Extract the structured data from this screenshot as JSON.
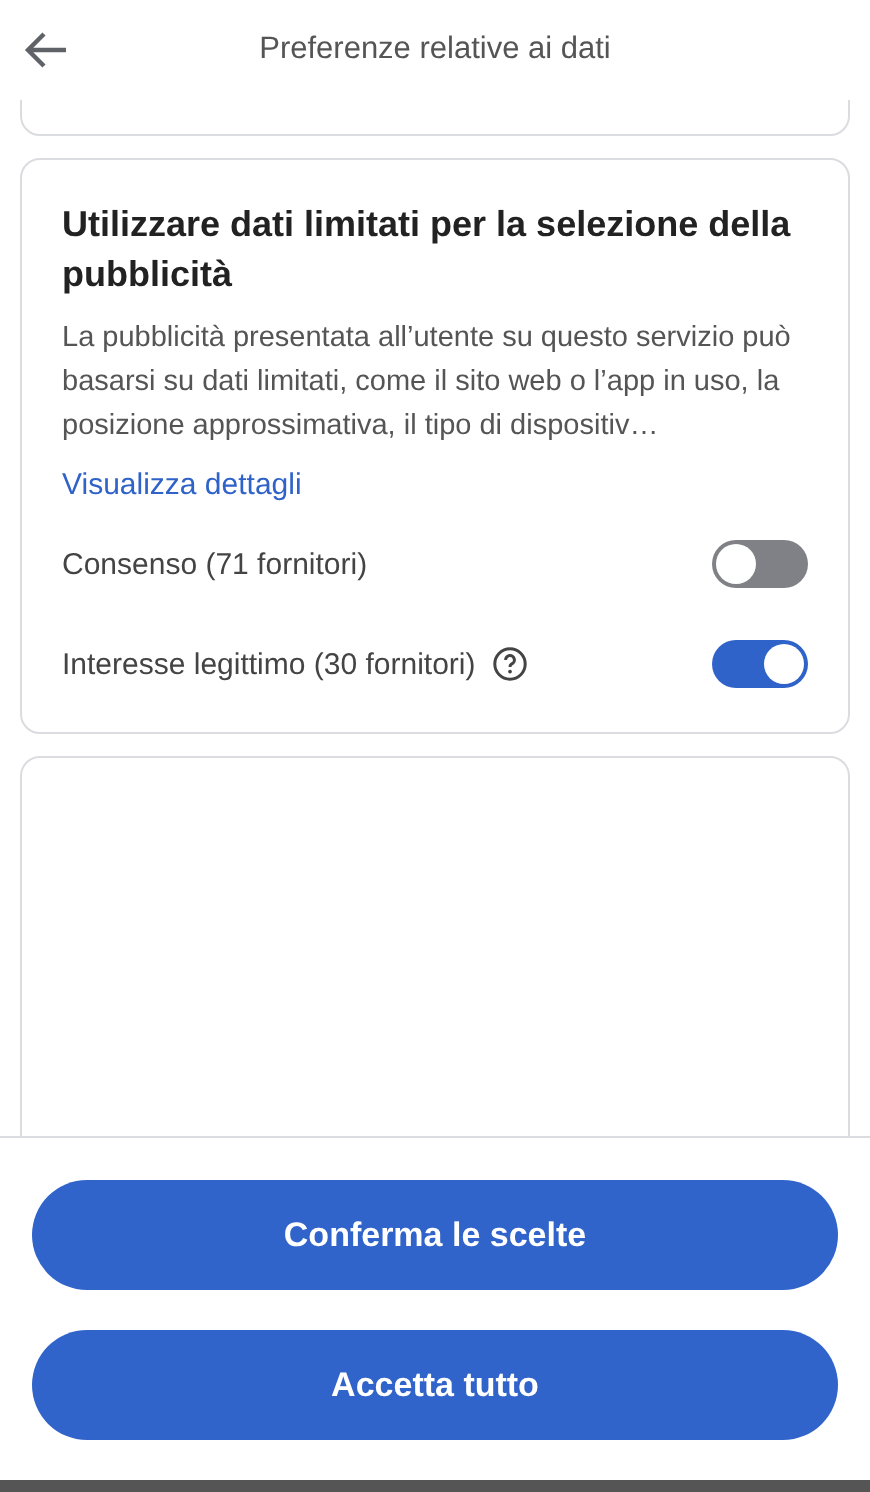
{
  "header": {
    "title": "Preferenze relative ai dati"
  },
  "section": {
    "title": "Utilizzare dati limitati per la selezione della pubblicità",
    "description": "La pubblicità presentata all’utente su questo servizio può basarsi su dati limitati, come il sito web o l’app in uso, la posizione approssimativa, il tipo di dispositiv…",
    "link": "Visualizza dettagli",
    "toggles": [
      {
        "label": "Consenso (71 fornitori)",
        "on": false
      },
      {
        "label": "Interesse legittimo (30 fornitori)",
        "on": true,
        "help": true
      }
    ]
  },
  "buttons": [
    "Conferma le scelte",
    "Accetta tutto"
  ]
}
